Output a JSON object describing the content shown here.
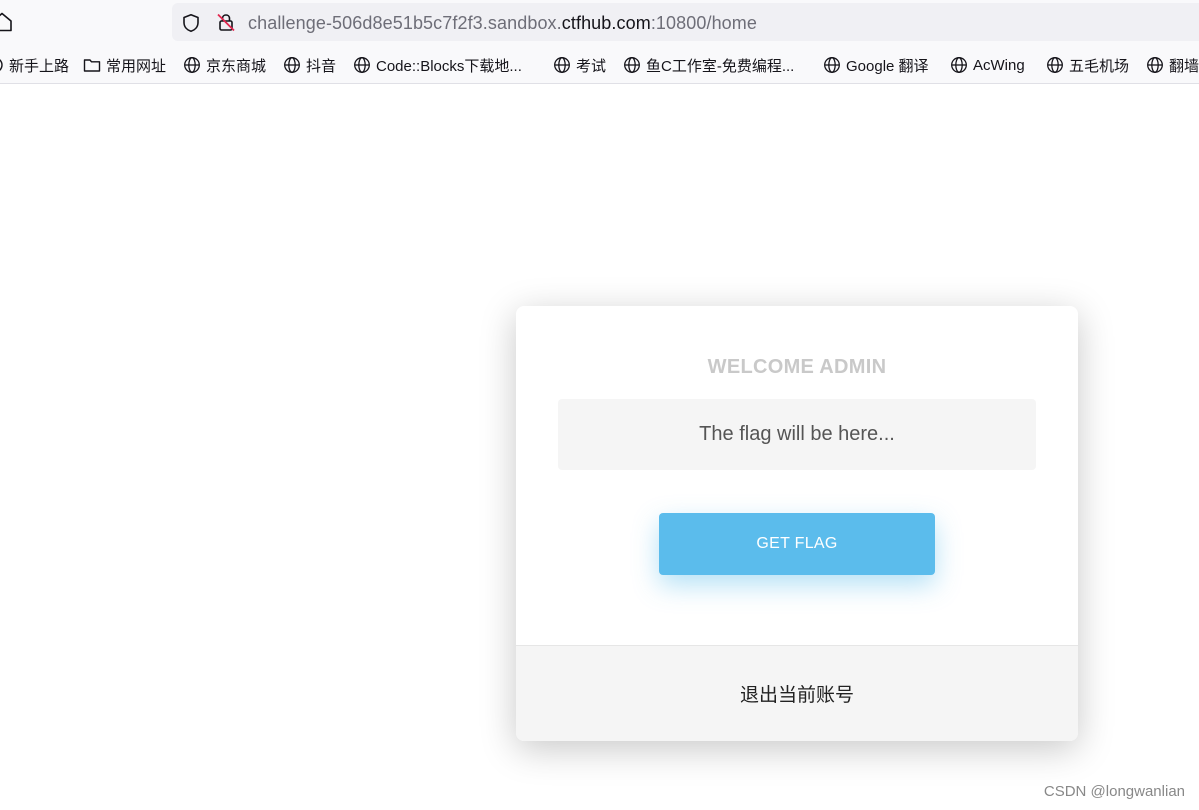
{
  "browser": {
    "url_prefix": "challenge-506d8e51b5c7f2f3.sandbox.",
    "url_domain": "ctfhub.com",
    "url_suffix": ":10800/home"
  },
  "bookmarks": [
    {
      "label": "新手上路",
      "icon": "bookmark-icon"
    },
    {
      "label": "常用网址",
      "icon": "folder-icon"
    },
    {
      "label": "京东商城",
      "icon": "globe-icon"
    },
    {
      "label": "抖音",
      "icon": "globe-icon"
    },
    {
      "label": "Code::Blocks下载地...",
      "icon": "globe-icon"
    },
    {
      "label": "考试",
      "icon": "globe-icon"
    },
    {
      "label": "鱼C工作室-免费编程...",
      "icon": "globe-icon"
    },
    {
      "label": "Google 翻译",
      "icon": "globe-icon"
    },
    {
      "label": "AcWing",
      "icon": "globe-icon"
    },
    {
      "label": "五毛机场",
      "icon": "globe-icon"
    },
    {
      "label": "翻墙",
      "icon": "globe-icon"
    }
  ],
  "card": {
    "title": "WELCOME ADMIN",
    "flag_placeholder": "The flag will be here...",
    "button_label": "GET FLAG",
    "logout_label": "退出当前账号"
  },
  "watermark": "CSDN @longwanlian",
  "colors": {
    "button": "#5bbcec",
    "title": "#c9c9c9",
    "panel": "#f5f5f5"
  }
}
